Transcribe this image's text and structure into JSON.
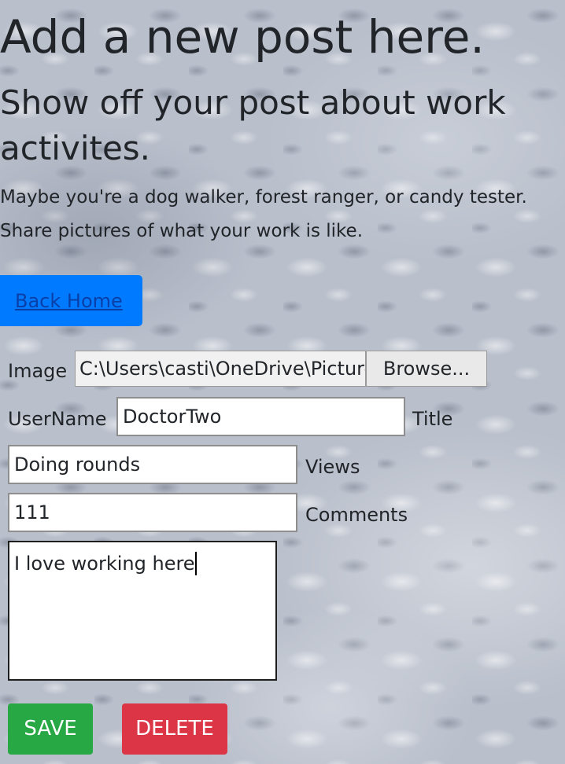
{
  "header": {
    "title": "Add a new post here.",
    "subtitle": "Show off your post about work activites.",
    "description_line1": "Maybe you're a dog walker, forest ranger, or candy tester.",
    "description_line2": "Share pictures of what your work is like."
  },
  "nav": {
    "back_home_label": "Back Home"
  },
  "form": {
    "image_label": "Image",
    "image_path": "C:\\Users\\casti\\OneDrive\\Pictures",
    "browse_label": "Browse...",
    "username_label": "UserName",
    "username_value": "DoctorTwo",
    "title_label": "Title",
    "title_value": "Doing rounds",
    "views_label": "Views",
    "views_value": "111",
    "comments_label": "Comments",
    "comments_value": "I love working here"
  },
  "actions": {
    "save_label": "SAVE",
    "delete_label": "DELETE"
  },
  "colors": {
    "primary": "#007bff",
    "success": "#28a745",
    "danger": "#dc3545"
  }
}
